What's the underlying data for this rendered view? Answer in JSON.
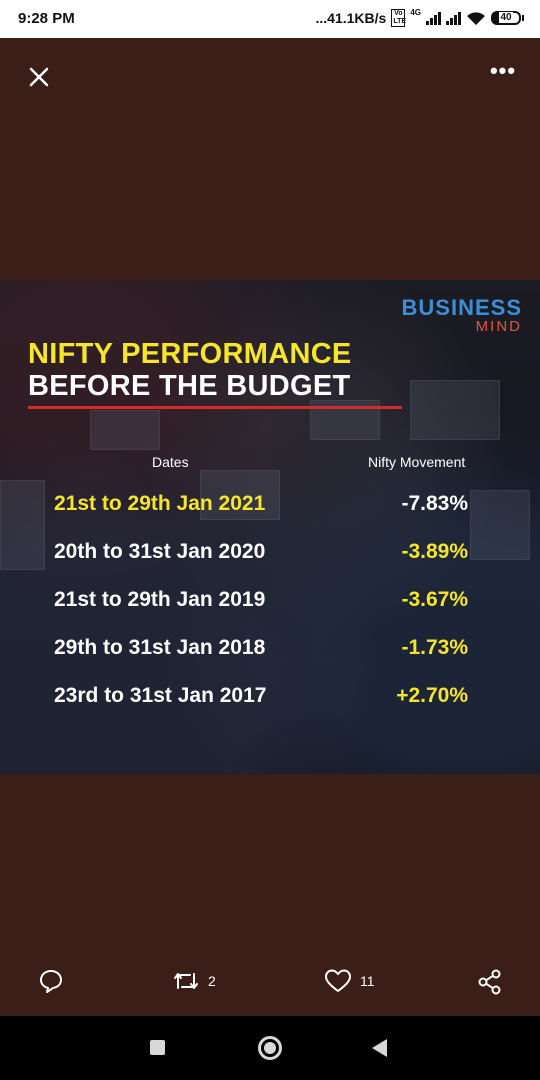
{
  "status_bar": {
    "time": "9:28 PM",
    "network_speed": "...41.1KB/s",
    "volte_label": "Vo LTE",
    "network_type": "4G",
    "battery": "40",
    "icons": [
      "signal-icon",
      "signal-icon",
      "wifi-icon",
      "battery-icon"
    ]
  },
  "viewer": {
    "close_icon": "close-icon",
    "more_icon": "more-options-icon"
  },
  "media": {
    "brand_main": "BUSINESS",
    "brand_sub": "MIND",
    "title_line1": "NIFTY PERFORMANCE",
    "title_line2": "BEFORE THE BUDGET",
    "col_dates": "Dates",
    "col_movement": "Nifty Movement",
    "rows": [
      {
        "date": "21st to 29th Jan 2021",
        "movement": "-7.83%"
      },
      {
        "date": "20th to 31st Jan 2020",
        "movement": "-3.89%"
      },
      {
        "date": "21st to 29th Jan 2019",
        "movement": "-3.67%"
      },
      {
        "date": "29th to 31st Jan 2018",
        "movement": "-1.73%"
      },
      {
        "date": "23rd to 31st Jan 2017",
        "movement": "+2.70%"
      }
    ],
    "colors": {
      "yellow": "#f5e62a",
      "red_rule": "#d42a2a",
      "brand_blue": "#3b8fd9",
      "brand_red": "#e2533f"
    }
  },
  "actions": {
    "reply_icon": "reply-icon",
    "retweet_icon": "retweet-icon",
    "retweet_count": "2",
    "like_icon": "heart-icon",
    "like_count": "11",
    "share_icon": "share-icon"
  },
  "navbar": {
    "recent_icon": "recents-icon",
    "home_icon": "home-icon",
    "back_icon": "back-icon"
  }
}
